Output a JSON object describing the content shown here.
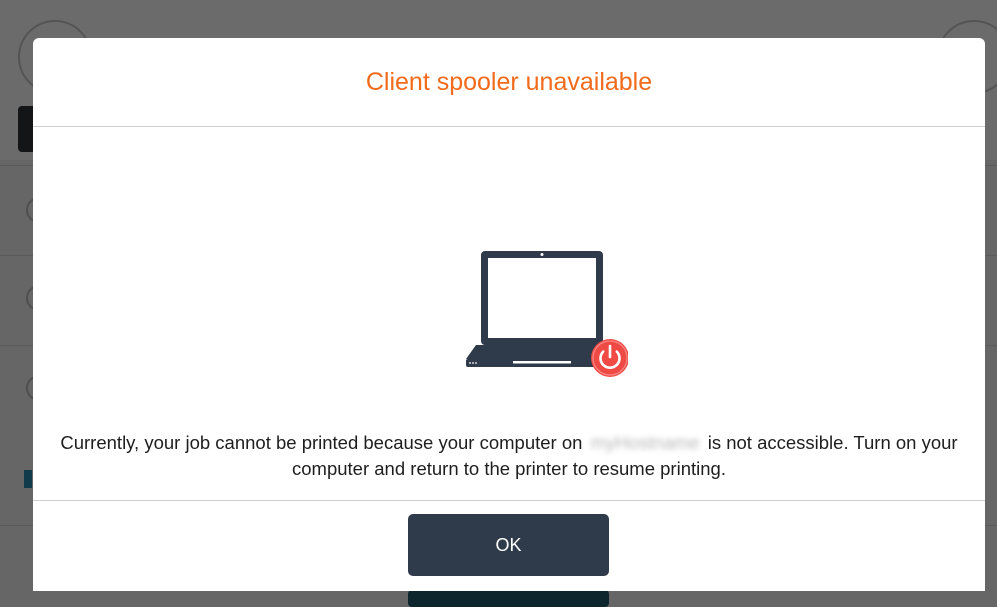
{
  "dialog": {
    "title": "Client spooler unavailable",
    "message_before": "Currently, your job cannot be printed because your computer on",
    "hostname": "myHostname",
    "message_after": "is not accessible. Turn on your computer and return to the printer to resume printing.",
    "ok_label": "OK",
    "illustration": {
      "laptop_icon": "laptop-icon",
      "power_icon": "power-off-icon"
    }
  },
  "colors": {
    "title": "#f26a1b",
    "button_bg": "#2f3a4a",
    "laptop": "#2f3a4a",
    "power_badge": "#f04a45"
  }
}
